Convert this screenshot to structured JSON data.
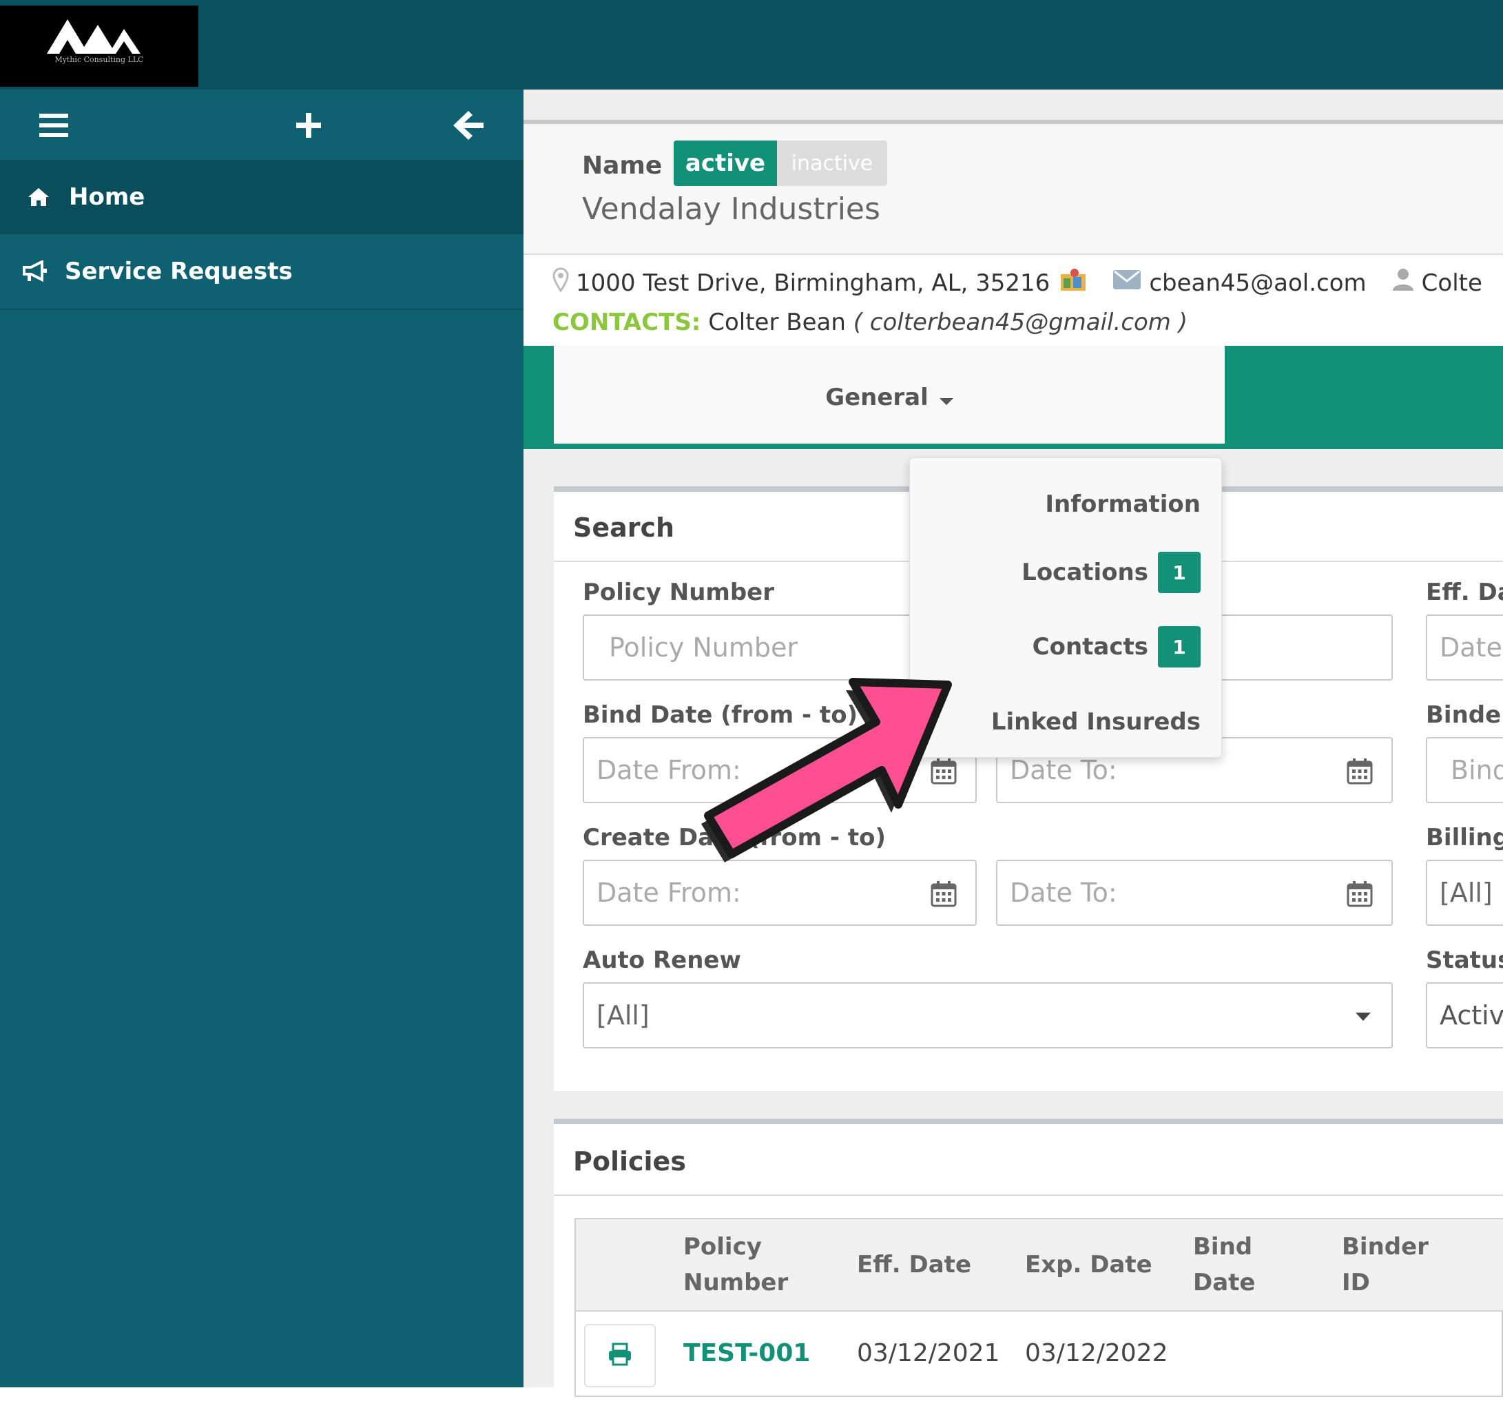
{
  "logo": {
    "subtitle": "Mythic Consulting LLC"
  },
  "sidebar": {
    "items": [
      {
        "label": "Home",
        "icon": "home-icon"
      },
      {
        "label": "Service Requests",
        "icon": "megaphone-icon"
      }
    ]
  },
  "header": {
    "name_label": "Name",
    "toggle_active": "active",
    "toggle_inactive": "inactive",
    "company": "Vendalay Industries"
  },
  "info": {
    "address": "1000 Test Drive, Birmingham, AL, 35216",
    "email": "cbean45@aol.com",
    "user": "Colte",
    "contacts_label": "CONTACTS:",
    "contact_name": "Colter Bean",
    "contact_email": "( colterbean45@gmail.com )"
  },
  "tab": {
    "label": "General"
  },
  "dropdown": {
    "items": [
      {
        "label": "Information"
      },
      {
        "label": "Locations",
        "badge": "1"
      },
      {
        "label": "Contacts",
        "badge": "1"
      },
      {
        "label": "Linked Insureds"
      }
    ]
  },
  "search": {
    "title": "Search",
    "policy_number_label": "Policy Number",
    "policy_number_placeholder": "Policy Number",
    "eff_date_label": "Eff. Dat",
    "eff_date_placeholder": "Date F",
    "bind_date_label": "Bind Date (from - to)",
    "binder_label": "Binder I",
    "binder_placeholder": "Binde",
    "create_date_label": "Create Date (from - to)",
    "billing_label": "Billing T",
    "billing_value": "[All]",
    "date_from": "Date From:",
    "date_to": "Date To:",
    "auto_renew_label": "Auto Renew",
    "auto_renew_value": "[All]",
    "status_label": "Status",
    "status_value": "Active"
  },
  "policies": {
    "title": "Policies",
    "columns": [
      "Policy Number",
      "Eff. Date",
      "Exp. Date",
      "Bind Date",
      "Binder ID"
    ],
    "rows": [
      {
        "policy_number": "TEST-001",
        "eff_date": "03/12/2021",
        "exp_date": "03/12/2022"
      }
    ]
  },
  "colors": {
    "teal_dark": "#0b515f",
    "teal": "#0f6070",
    "green": "#129078",
    "contacts_green": "#8cc63f",
    "arrow_pink": "#ff4f93"
  }
}
